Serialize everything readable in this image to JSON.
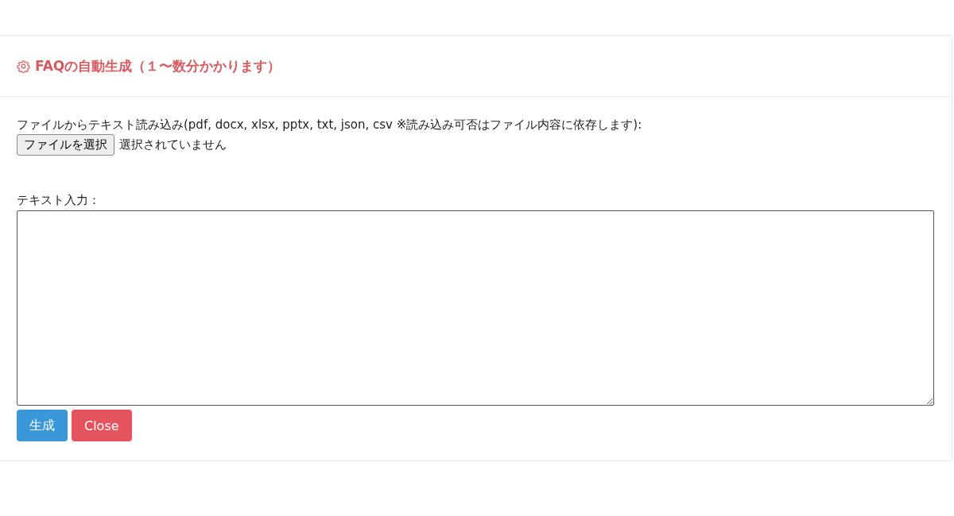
{
  "dialog": {
    "title": "FAQの自動生成（１〜数分かかります）",
    "file_label": "ファイルからテキスト読み込み(pdf, docx, xlsx, pptx, txt, json, csv ※読み込み可否はファイル内容に依存します):",
    "file_button": "ファイルを選択",
    "file_status": "選択されていません",
    "text_label": "テキスト入力：",
    "buttons": [
      {
        "label": "生成",
        "kind": "primary"
      },
      {
        "label": "Close",
        "kind": "danger"
      }
    ]
  }
}
